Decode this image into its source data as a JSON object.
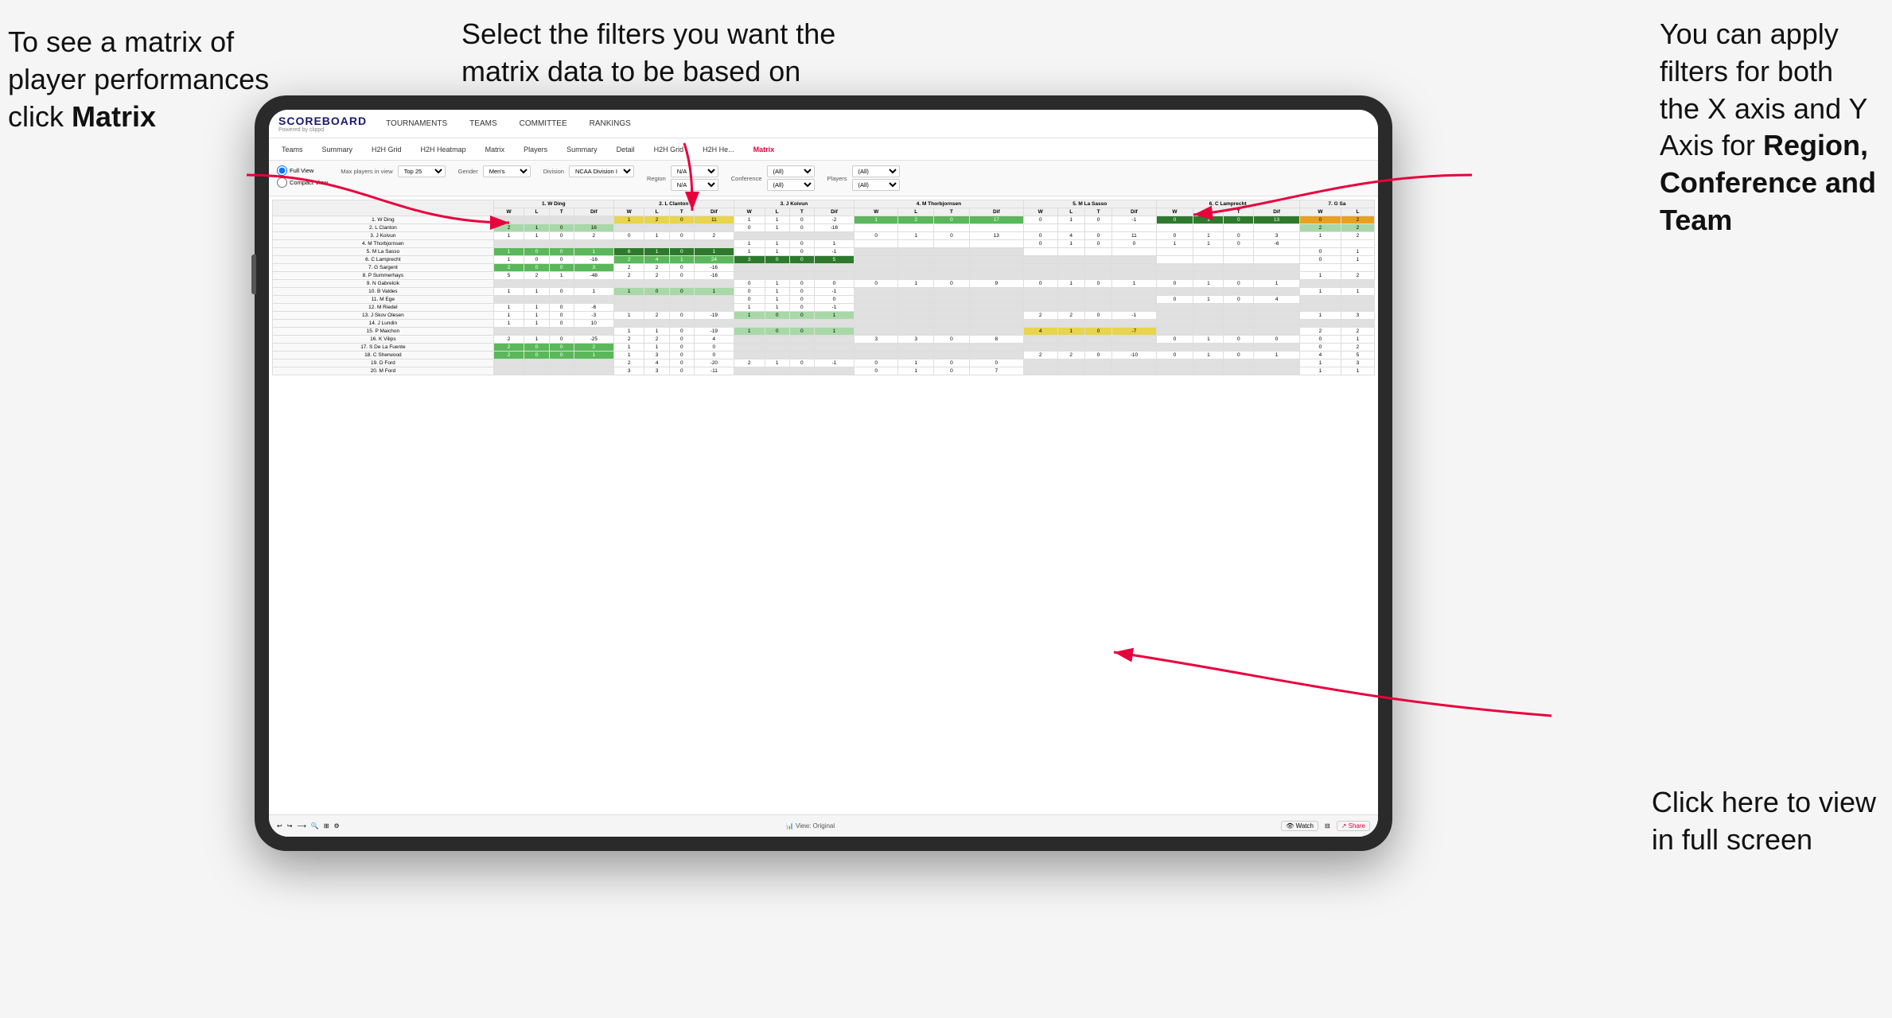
{
  "annotations": {
    "top_left": {
      "line1": "To see a matrix of",
      "line2": "player performances",
      "line3_normal": "click ",
      "line3_bold": "Matrix"
    },
    "top_center": {
      "line1": "Select the filters you want the",
      "line2": "matrix data to be based on"
    },
    "top_right": {
      "line1": "You  can apply",
      "line2": "filters for both",
      "line3": "the X axis and Y",
      "line4_normal": "Axis for ",
      "line4_bold": "Region,",
      "line5_bold": "Conference and",
      "line6_bold": "Team"
    },
    "bottom_right": {
      "line1": "Click here to view",
      "line2": "in full screen"
    }
  },
  "app": {
    "logo": "SCOREBOARD",
    "logo_sub": "Powered by clippd",
    "nav": [
      "TOURNAMENTS",
      "TEAMS",
      "COMMITTEE",
      "RANKINGS"
    ],
    "sub_nav": [
      "Teams",
      "Summary",
      "H2H Grid",
      "H2H Heatmap",
      "Matrix",
      "Players",
      "Summary",
      "Detail",
      "H2H Grid",
      "H2H He...",
      "Matrix"
    ],
    "active_sub_nav": "Matrix"
  },
  "filters": {
    "view_options": [
      "Full View",
      "Compact View"
    ],
    "active_view": "Full View",
    "max_players_label": "Max players in view",
    "max_players_value": "Top 25",
    "gender_label": "Gender",
    "gender_value": "Men's",
    "division_label": "Division",
    "division_value": "NCAA Division I",
    "region_label": "Region",
    "region_value1": "N/A",
    "region_value2": "N/A",
    "conference_label": "Conference",
    "conference_value1": "(All)",
    "conference_value2": "(All)",
    "players_label": "Players",
    "players_value1": "(All)",
    "players_value2": "(All)"
  },
  "matrix": {
    "col_headers": [
      "1. W Ding",
      "2. L Clanton",
      "3. J Koivun",
      "4. M Thorbjornsen",
      "5. M La Sasso",
      "6. C Lamprecht",
      "7. G Sa"
    ],
    "sub_headers": [
      "W",
      "L",
      "T",
      "Dif"
    ],
    "rows": [
      {
        "name": "1. W Ding",
        "data": [
          [
            null,
            null,
            null,
            null
          ],
          [
            1,
            2,
            0,
            11
          ],
          [
            1,
            1,
            0,
            -2
          ],
          [
            1,
            2,
            0,
            17
          ],
          [
            0,
            1,
            0,
            -1
          ],
          [
            0,
            1,
            0,
            13
          ],
          [
            0,
            2
          ]
        ],
        "colors": [
          "gray",
          "yellow",
          "white",
          "green-mid",
          "white",
          "green-dark",
          "orange"
        ]
      },
      {
        "name": "2. L Clanton",
        "data": [
          [
            2,
            1,
            0,
            16
          ],
          [
            null,
            null,
            null,
            null
          ],
          [],
          [],
          [],
          [],
          []
        ]
      },
      {
        "name": "3. J Koivun"
      },
      {
        "name": "4. M Thorbjornsen"
      },
      {
        "name": "5. M La Sasso"
      },
      {
        "name": "6. C Lamprecht"
      },
      {
        "name": "7. G Sargent"
      },
      {
        "name": "8. P Summerhays"
      },
      {
        "name": "9. N Gabrelcik"
      },
      {
        "name": "10. B Valdes"
      },
      {
        "name": "11. M Ege"
      },
      {
        "name": "12. M Riedel"
      },
      {
        "name": "13. J Skov Olesen"
      },
      {
        "name": "14. J Lundin"
      },
      {
        "name": "15. P Maichon"
      },
      {
        "name": "16. K Vilips"
      },
      {
        "name": "17. S De La Fuente"
      },
      {
        "name": "18. C Sherwood"
      },
      {
        "name": "19. D Ford"
      },
      {
        "name": "20. M Ford"
      }
    ]
  },
  "toolbar": {
    "view_original": "View: Original",
    "watch": "Watch",
    "share": "Share"
  }
}
